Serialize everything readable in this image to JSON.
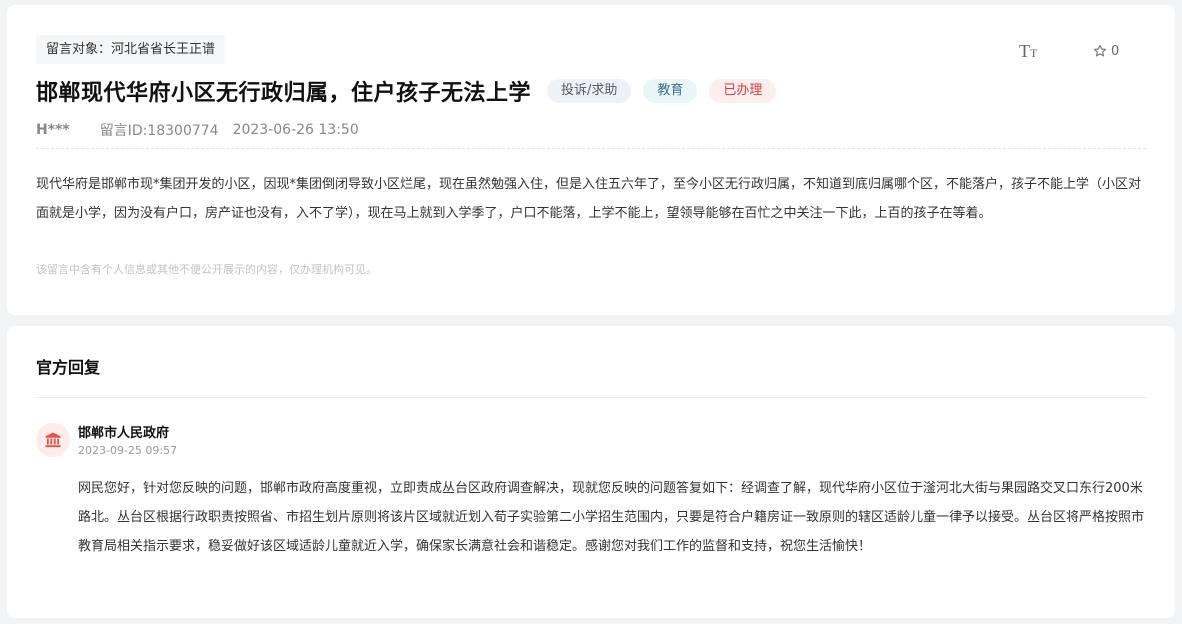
{
  "message": {
    "target_label": "留言对象：河北省省长王正谱",
    "font_size_toggle": {
      "big": "T",
      "small": "T"
    },
    "favorite": {
      "icon": "star-outline-icon",
      "count": "0"
    },
    "title": "邯郸现代华府小区无行政归属，住户孩子无法上学",
    "tags": {
      "type": "投诉/求助",
      "category": "教育",
      "status": "已办理"
    },
    "author": "H***",
    "message_id": "留言ID:18300774",
    "datetime": "2023-06-26 13:50",
    "body": "现代华府是邯郸市现*集团开发的小区，因现*集团倒闭导致小区烂尾，现在虽然勉强入住，但是入住五六年了，至今小区无行政归属，不知道到底归属哪个区，不能落户，孩子不能上学（小区对面就是小学，因为没有户口，房产证也没有，入不了学），现在马上就到入学季了，户口不能落，上学不能上，望领导能够在百忙之中关注一下此，上百的孩子在等着。",
    "privacy_note": "该留言中含有个人信息或其他不便公开展示的内容，仅办理机构可见。"
  },
  "reply": {
    "heading": "官方回复",
    "org_icon": "government-building-icon",
    "org_name": "邯郸市人民政府",
    "datetime": "2023-09-25 09:57",
    "body": "网民您好，针对您反映的问题，邯郸市政府高度重视，立即责成丛台区政府调查解决，现就您反映的问题答复如下：经调查了解，现代华府小区位于滏河北大街与果园路交叉口东行200米路北。丛台区根据行政职责按照省、市招生划片原则将该片区域就近划入荀子实验第二小学招生范围内，只要是符合户籍房证一致原则的辖区适龄儿童一律予以接受。丛台区将严格按照市教育局相关指示要求，稳妥做好该区域适龄儿童就近入学，确保家长满意社会和谐稳定。感谢您对我们工作的监督和支持，祝您生活愉快！"
  },
  "colors": {
    "page_bg": "#f2f3f5",
    "status_red": "#d43c3c",
    "category_teal": "#3f6f8a",
    "avatar_bg": "#fdeceb",
    "avatar_icon": "#e0534a"
  }
}
